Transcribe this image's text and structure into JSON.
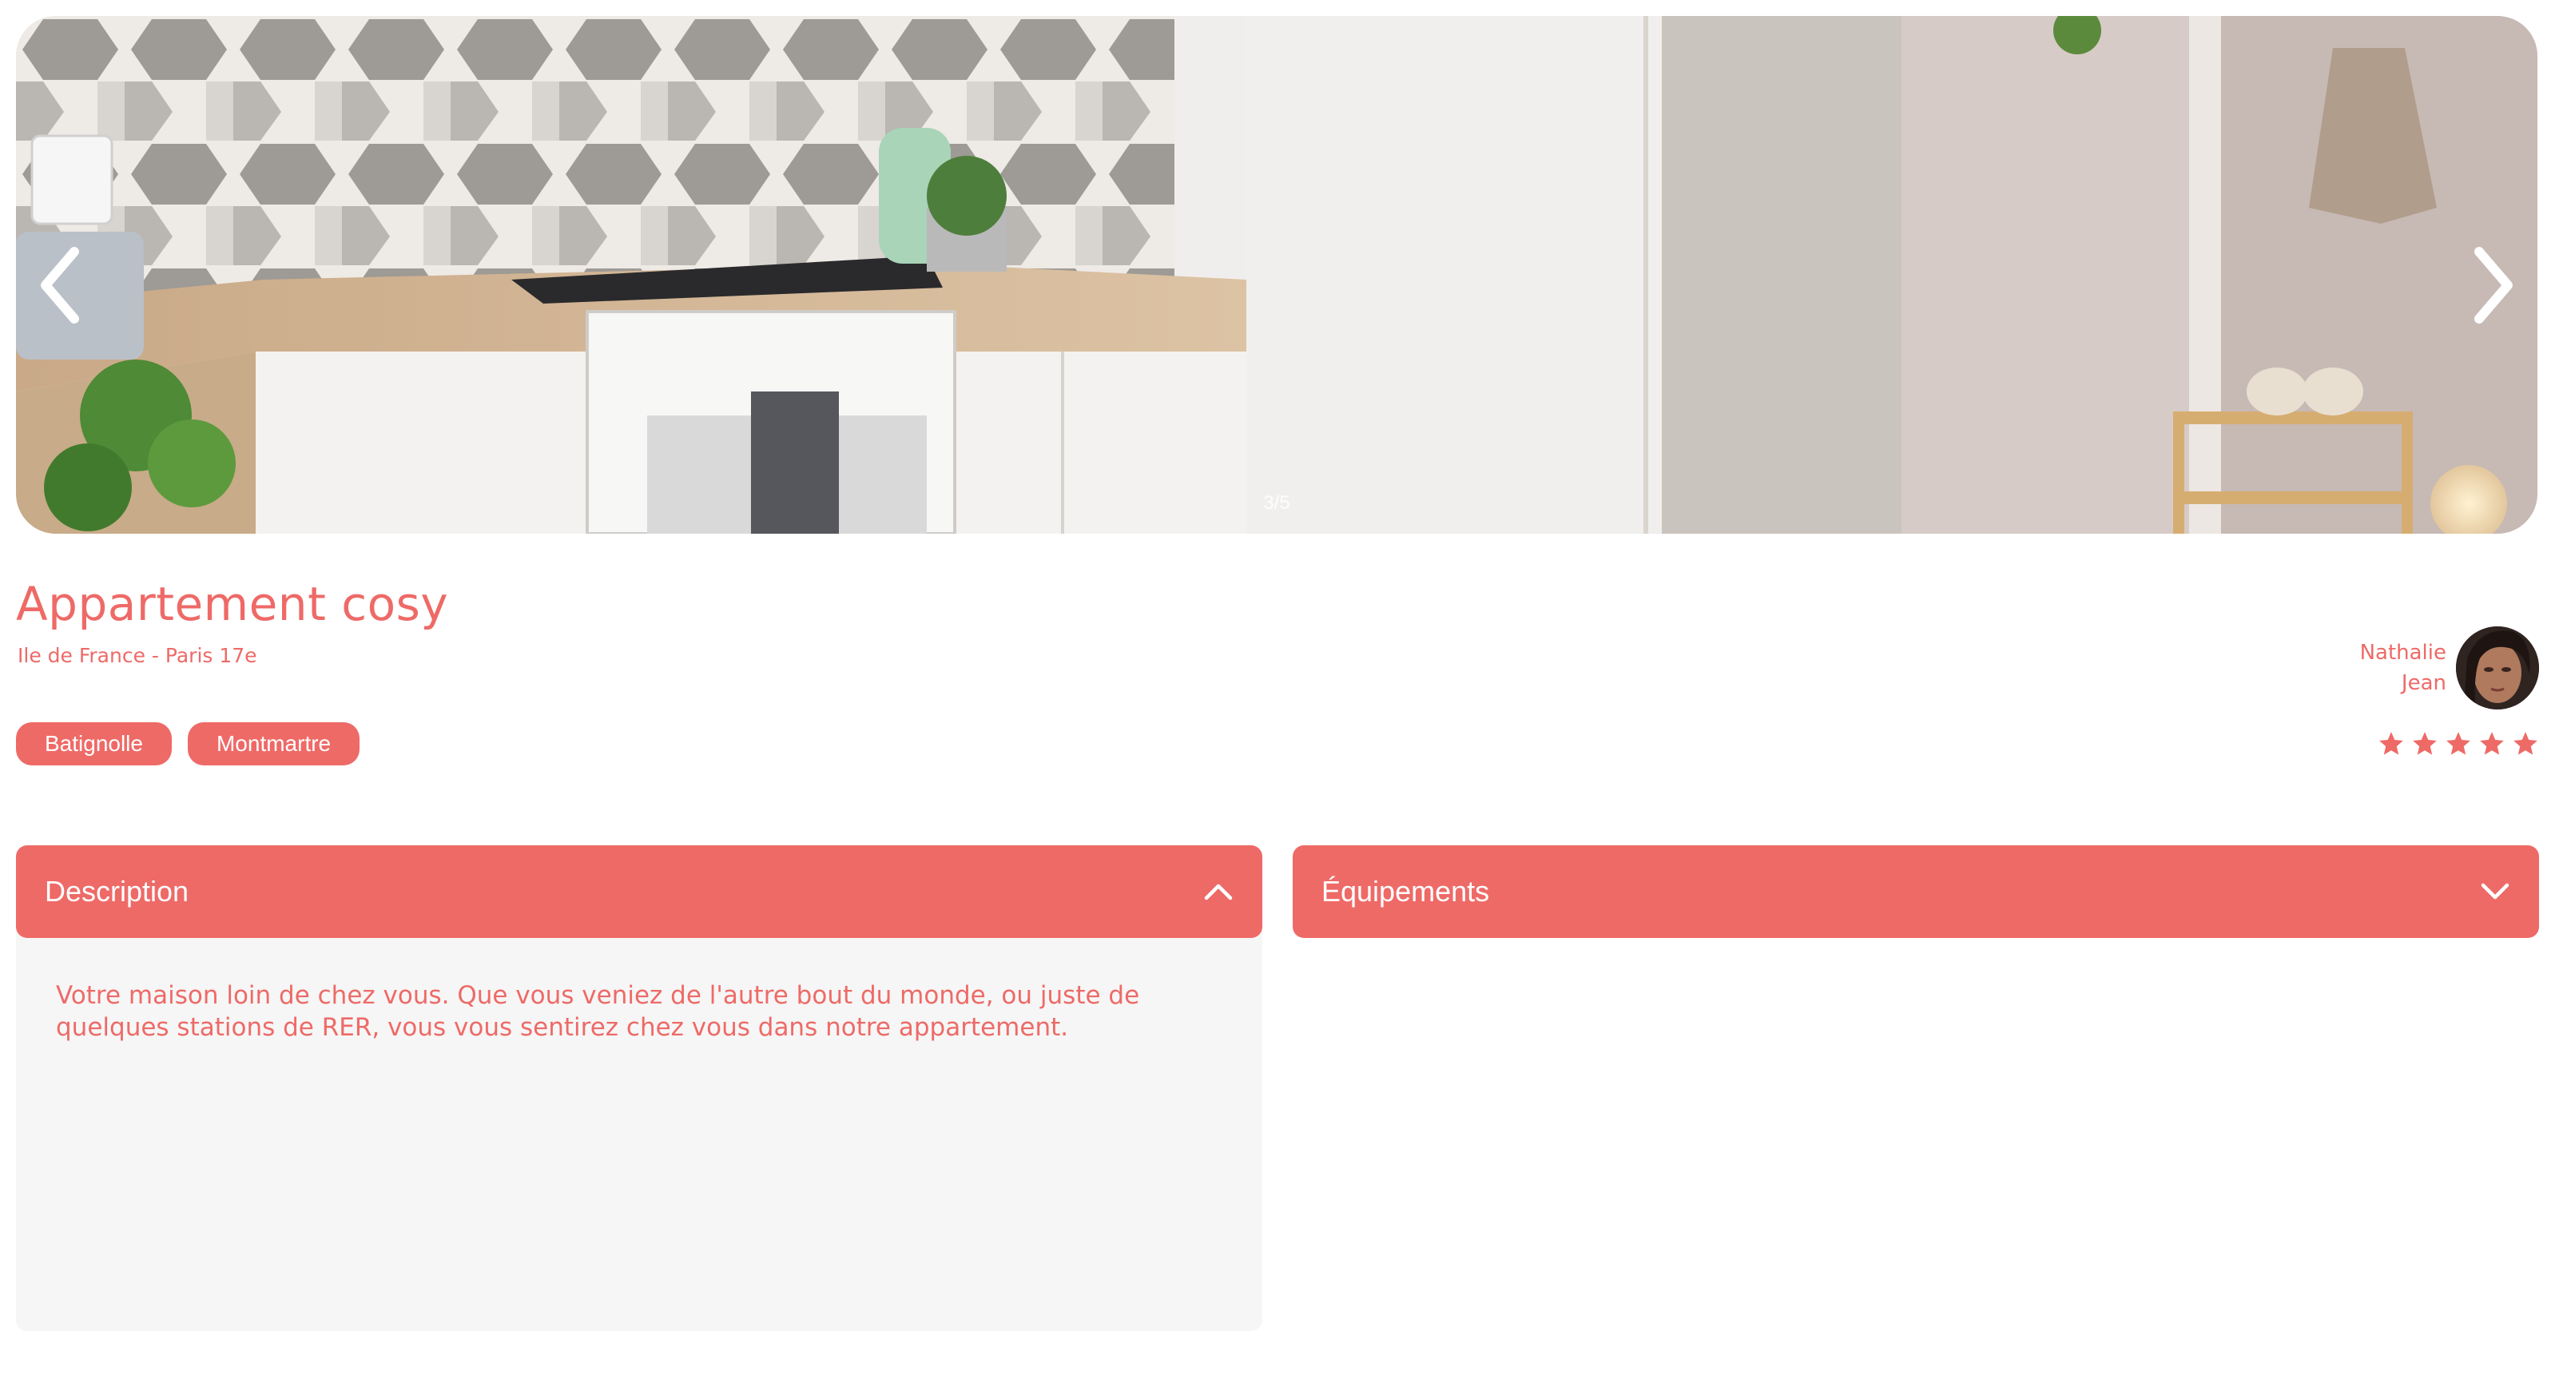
{
  "gallery": {
    "counter": "3/5",
    "prev_icon": "chevron-left-icon",
    "next_icon": "chevron-right-icon"
  },
  "listing": {
    "title": "Appartement cosy",
    "location": "Ile de France - Paris 17e",
    "tags": [
      "Batignolle",
      "Montmartre"
    ]
  },
  "host": {
    "first_name": "Nathalie",
    "last_name": "Jean"
  },
  "rating": {
    "value": 5,
    "max": 5
  },
  "collapses": {
    "description": {
      "title": "Description",
      "state": "open",
      "text": "Votre maison loin de chez vous. Que vous veniez de l'autre bout du monde, ou juste de quelques stations de RER, vous vous sentirez chez vous dans notre appartement."
    },
    "equipments": {
      "title": "Équipements",
      "state": "closed"
    }
  },
  "colors": {
    "accent": "#ee6a67",
    "panel": "#f6f6f6"
  }
}
